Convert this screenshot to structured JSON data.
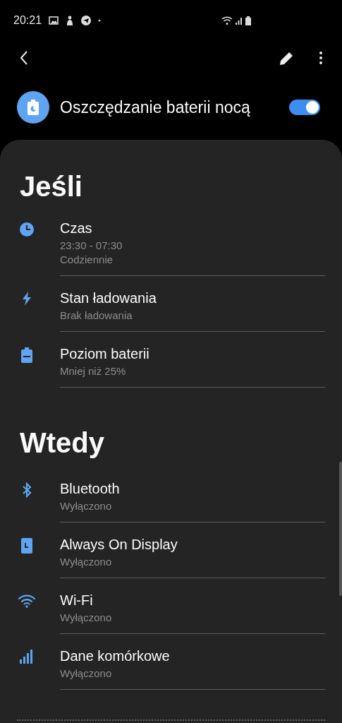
{
  "status_bar": {
    "time": "20:21"
  },
  "master": {
    "title": "Oszczędzanie baterii nocą",
    "on": true
  },
  "sections": [
    {
      "heading": "Jeśli",
      "items": [
        {
          "title": "Czas",
          "details": [
            "23:30 - 07:30",
            "Codziennie"
          ]
        },
        {
          "title": "Stan ładowania",
          "details": [
            "Brak ładowania"
          ]
        },
        {
          "title": "Poziom baterii",
          "details": [
            "Mniej niż 25%"
          ]
        }
      ]
    },
    {
      "heading": "Wtedy",
      "items": [
        {
          "title": "Bluetooth",
          "details": [
            "Wyłączono"
          ]
        },
        {
          "title": "Always On Display",
          "details": [
            "Wyłączono"
          ]
        },
        {
          "title": "Wi-Fi",
          "details": [
            "Wyłączono"
          ]
        },
        {
          "title": "Dane komórkowe",
          "details": [
            "Wyłączono"
          ]
        }
      ]
    }
  ]
}
